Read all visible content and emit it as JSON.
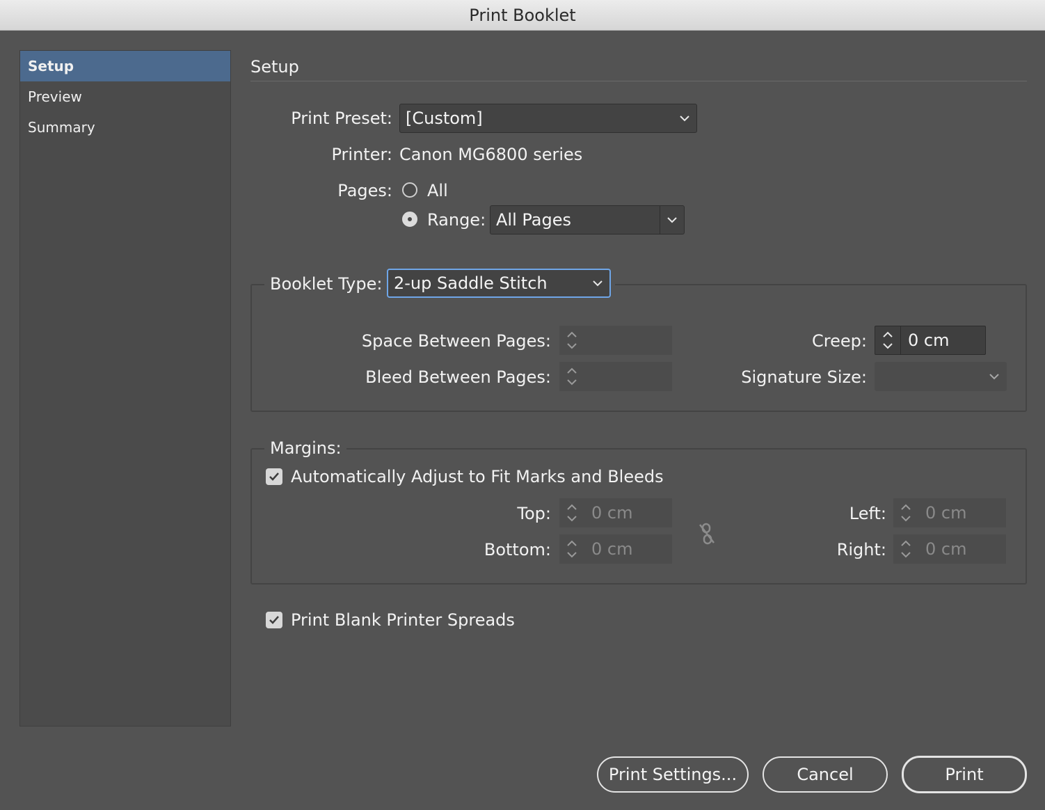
{
  "window": {
    "title": "Print Booklet"
  },
  "sidebar": {
    "items": [
      {
        "label": "Setup",
        "selected": true
      },
      {
        "label": "Preview",
        "selected": false
      },
      {
        "label": "Summary",
        "selected": false
      }
    ]
  },
  "setup": {
    "heading": "Setup",
    "print_preset_label": "Print Preset:",
    "print_preset_value": "[Custom]",
    "printer_label": "Printer:",
    "printer_value": "Canon MG6800 series",
    "pages_label": "Pages:",
    "pages_all_label": "All",
    "pages_range_label": "Range:",
    "pages_range_value": "All Pages",
    "pages_selected": "Range"
  },
  "booklet": {
    "type_label": "Booklet Type:",
    "type_value": "2-up Saddle Stitch",
    "space_between_label": "Space Between Pages:",
    "space_between_value": "",
    "bleed_between_label": "Bleed Between Pages:",
    "bleed_between_value": "",
    "creep_label": "Creep:",
    "creep_value": "0 cm",
    "signature_label": "Signature Size:",
    "signature_value": ""
  },
  "margins": {
    "label": "Margins:",
    "auto_adjust_label": "Automatically Adjust to Fit Marks and Bleeds",
    "auto_adjust_checked": true,
    "top_label": "Top:",
    "top_value": "0 cm",
    "bottom_label": "Bottom:",
    "bottom_value": "0 cm",
    "left_label": "Left:",
    "left_value": "0 cm",
    "right_label": "Right:",
    "right_value": "0 cm"
  },
  "options": {
    "print_blank_label": "Print Blank Printer Spreads",
    "print_blank_checked": true
  },
  "footer": {
    "print_settings_label": "Print Settings...",
    "cancel_label": "Cancel",
    "print_label": "Print"
  },
  "colors": {
    "background": "#535353",
    "selection": "#4c6a8e",
    "focus_ring": "#6fa6e8"
  }
}
